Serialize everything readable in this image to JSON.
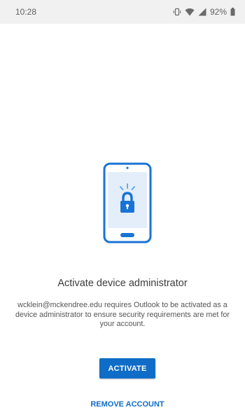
{
  "status_bar": {
    "time": "10:28",
    "battery": "92%",
    "icons": [
      "vibrate-icon",
      "wifi-icon",
      "signal-icon",
      "battery-icon"
    ]
  },
  "content": {
    "illustration_icon": "phone-lock-icon",
    "title": "Activate device administrator",
    "message": "wcklein@mckendree.edu requires Outlook to be activated as a device administrator to ensure security requirements are met for your account."
  },
  "buttons": {
    "activate_label": "ACTIVATE",
    "remove_label": "REMOVE ACCOUNT"
  },
  "colors": {
    "accent": "#0f6cc7",
    "status_bar_bg": "#f1f1f1"
  }
}
